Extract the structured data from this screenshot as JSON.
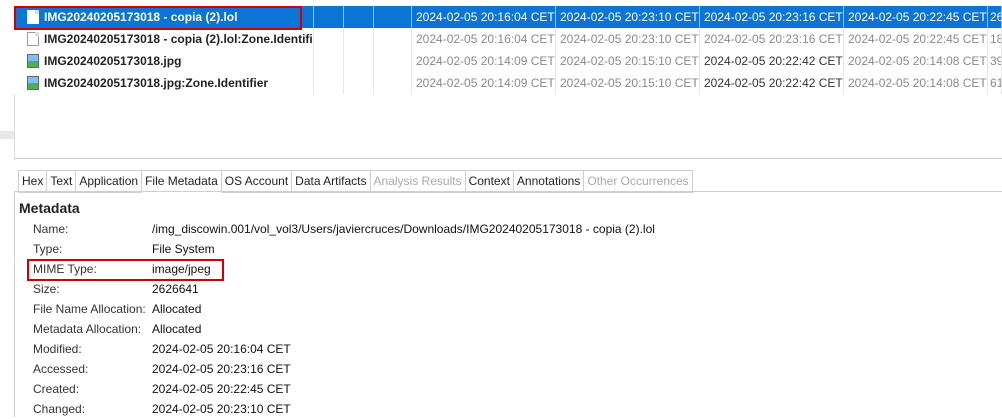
{
  "files": [
    {
      "name": "IMG20240205173018 - copia (2).lol",
      "icon": "document-icon",
      "selected": true,
      "dates": [
        "2024-02-05 20:16:04 CET",
        "2024-02-05 20:23:10 CET",
        "2024-02-05 20:23:16 CET",
        "2024-02-05 20:22:45 CET"
      ],
      "extra": "26"
    },
    {
      "name": "IMG20240205173018 - copia (2).lol:Zone.Identifier",
      "icon": "document-icon",
      "selected": false,
      "dates": [
        "2024-02-05 20:16:04 CET",
        "2024-02-05 20:23:10 CET",
        "2024-02-05 20:23:16 CET",
        "2024-02-05 20:22:45 CET"
      ],
      "extra": "18"
    },
    {
      "name": "IMG20240205173018.jpg",
      "icon": "image-file-icon",
      "selected": false,
      "dates": [
        "2024-02-05 20:14:09 CET",
        "2024-02-05 20:15:10 CET",
        "2024-02-05 20:22:42 CET",
        "2024-02-05 20:14:08 CET"
      ],
      "extra": "39"
    },
    {
      "name": "IMG20240205173018.jpg:Zone.Identifier",
      "icon": "image-file-icon",
      "selected": false,
      "dates": [
        "2024-02-05 20:14:09 CET",
        "2024-02-05 20:15:10 CET",
        "2024-02-05 20:22:42 CET",
        "2024-02-05 20:14:08 CET"
      ],
      "extra": "61"
    }
  ],
  "tabs": [
    {
      "label": "Hex",
      "state": "normal"
    },
    {
      "label": "Text",
      "state": "normal"
    },
    {
      "label": "Application",
      "state": "normal"
    },
    {
      "label": "File Metadata",
      "state": "active"
    },
    {
      "label": "OS Account",
      "state": "normal"
    },
    {
      "label": "Data Artifacts",
      "state": "normal"
    },
    {
      "label": "Analysis Results",
      "state": "disabled"
    },
    {
      "label": "Context",
      "state": "normal"
    },
    {
      "label": "Annotations",
      "state": "normal"
    },
    {
      "label": "Other Occurrences",
      "state": "disabled"
    }
  ],
  "metadata": {
    "title": "Metadata",
    "rows": [
      {
        "label": "Name:",
        "value": "/img_discowin.001/vol_vol3/Users/javiercruces/Downloads/IMG20240205173018 - copia (2).lol"
      },
      {
        "label": "Type:",
        "value": "File System"
      },
      {
        "label": "MIME Type:",
        "value": "image/jpeg"
      },
      {
        "label": "Size:",
        "value": "2626641"
      },
      {
        "label": "File Name Allocation:",
        "value": "Allocated"
      },
      {
        "label": "Metadata Allocation:",
        "value": "Allocated"
      },
      {
        "label": "Modified:",
        "value": "2024-02-05 20:16:04 CET"
      },
      {
        "label": "Accessed:",
        "value": "2024-02-05 20:23:16 CET"
      },
      {
        "label": "Created:",
        "value": "2024-02-05 20:22:45 CET"
      },
      {
        "label": "Changed:",
        "value": "2024-02-05 20:23:10 CET"
      }
    ]
  },
  "colors": {
    "selection": "#0b74d4",
    "highlight_box": "#d40000"
  }
}
